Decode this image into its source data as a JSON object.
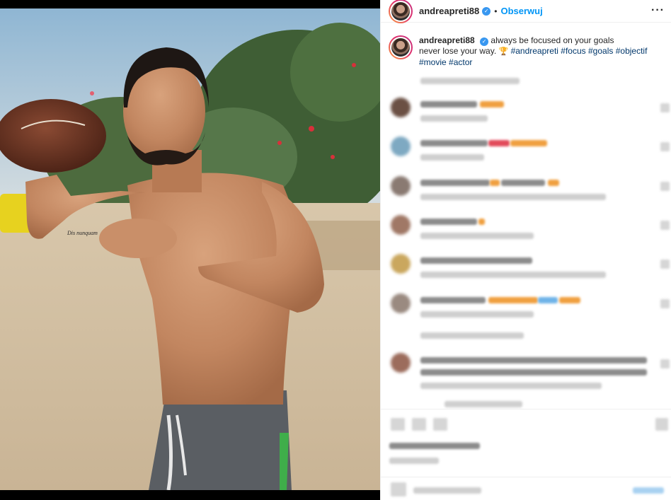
{
  "post": {
    "username": "andreapreti88",
    "follow_label": "Obserwuj",
    "dot": "•",
    "more_icon": "more-options-icon",
    "verified_icon": "verified-badge-icon"
  },
  "caption": {
    "username": "andreapreti88",
    "line1": "always be focused on your goals",
    "line2": "never lose your way.",
    "trophy": "🏆",
    "hashtags_line2": [
      "#andreapreti",
      "#focus",
      "#goals",
      "#objectif"
    ],
    "hashtags_line3": [
      "#movie",
      "#actor"
    ]
  },
  "colors": {
    "follow": "#0095f6",
    "hashtag": "#00376b",
    "avatar_ring_start": "#f9a03f",
    "avatar_ring_end": "#c13584"
  }
}
